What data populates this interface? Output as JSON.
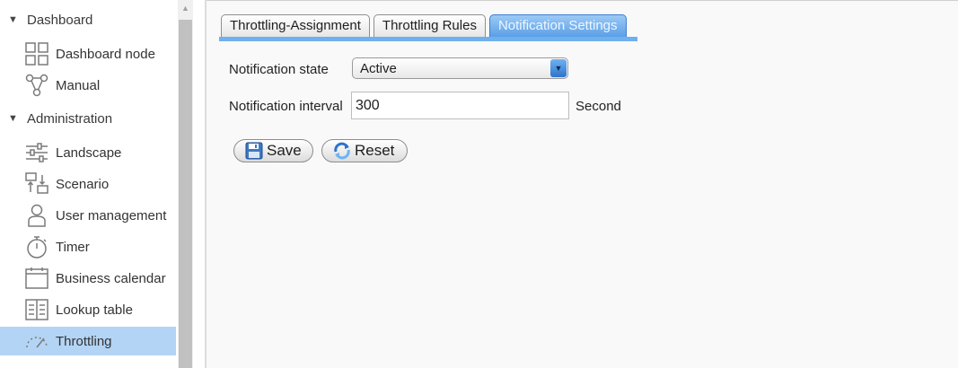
{
  "sidebar": {
    "sections": [
      {
        "label": "Dashboard",
        "items": [
          {
            "label": "Dashboard node",
            "icon": "grid-icon"
          },
          {
            "label": "Manual",
            "icon": "network-icon"
          }
        ]
      },
      {
        "label": "Administration",
        "items": [
          {
            "label": "Landscape",
            "icon": "sliders-icon"
          },
          {
            "label": "Scenario",
            "icon": "scenario-icon"
          },
          {
            "label": "User management",
            "icon": "user-icon"
          },
          {
            "label": "Timer",
            "icon": "stopwatch-icon"
          },
          {
            "label": "Business calendar",
            "icon": "calendar-icon"
          },
          {
            "label": "Lookup table",
            "icon": "table-icon"
          },
          {
            "label": "Throttling",
            "icon": "gauge-icon",
            "selected": true
          }
        ]
      }
    ]
  },
  "tabs": [
    {
      "label": "Throttling-Assignment",
      "active": false
    },
    {
      "label": "Throttling Rules",
      "active": false
    },
    {
      "label": "Notification Settings",
      "active": true
    }
  ],
  "form": {
    "state_label": "Notification state",
    "state_value": "Active",
    "interval_label": "Notification interval",
    "interval_value": "300",
    "interval_unit": "Second"
  },
  "buttons": {
    "save": "Save",
    "reset": "Reset"
  },
  "colors": {
    "selected_bg": "#b3d4f5",
    "active_tab": "#5b9fe6",
    "tab_underline": "#6fb0ee"
  }
}
